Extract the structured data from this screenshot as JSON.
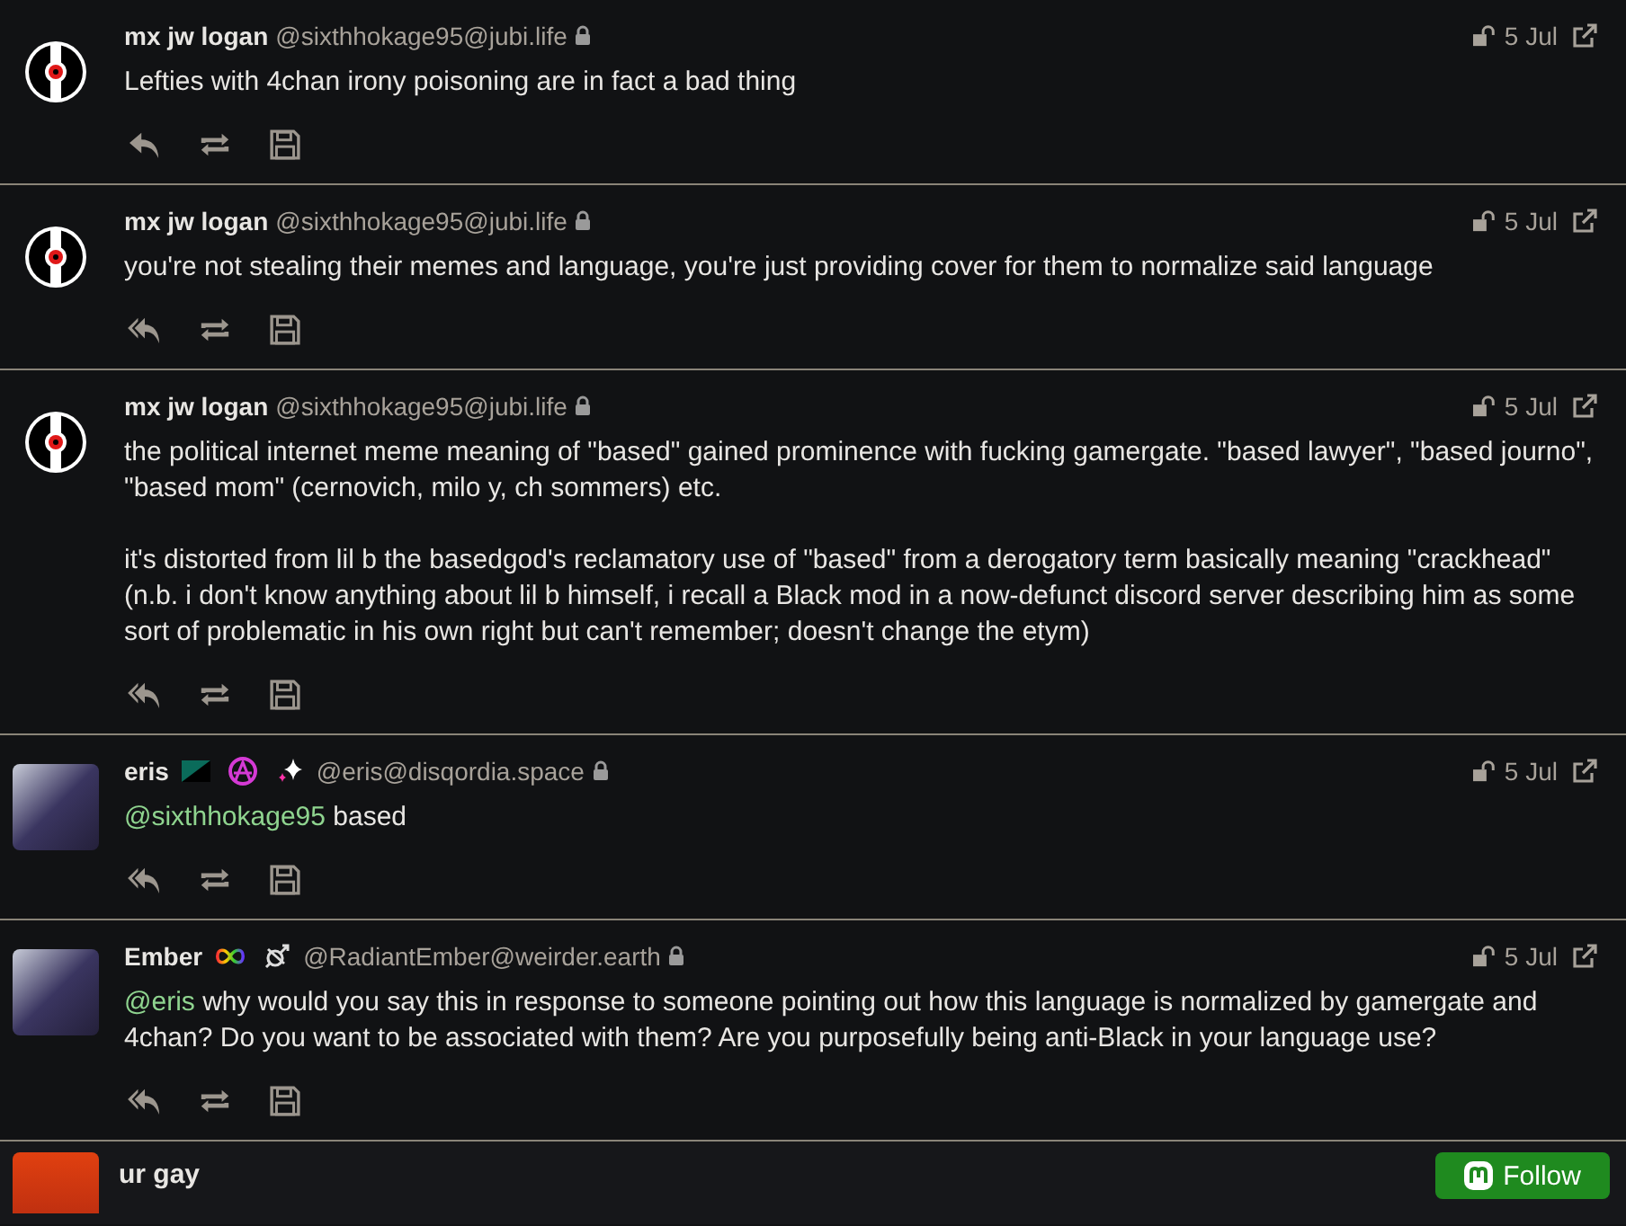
{
  "posts": [
    {
      "name": "mx jw logan",
      "handle": "@sixthhokage95@jubi.life",
      "avatar": {
        "kind": "record"
      },
      "date": "5 Jul",
      "reply": {
        "kind": "single"
      },
      "paragraphs": [
        {
          "text": "Lefties with 4chan irony poisoning are in fact a bad thing"
        }
      ]
    },
    {
      "name": "mx jw logan",
      "handle": "@sixthhokage95@jubi.life",
      "avatar": {
        "kind": "record"
      },
      "date": "5 Jul",
      "reply": {
        "kind": "all"
      },
      "paragraphs": [
        {
          "text": "you're not stealing their memes and language, you're just providing cover for them to normalize said language"
        }
      ]
    },
    {
      "name": "mx jw logan",
      "handle": "@sixthhokage95@jubi.life",
      "avatar": {
        "kind": "record"
      },
      "date": "5 Jul",
      "reply": {
        "kind": "all"
      },
      "paragraphs": [
        {
          "text": "the political internet meme meaning of \"based\" gained prominence with fucking gamergate. \"based lawyer\", \"based journo\", \"based mom\" (cernovich, milo y, ch sommers) etc."
        },
        {
          "text": "it's distorted from lil b the basedgod's reclamatory use of \"based\" from a derogatory term basically meaning \"crackhead\" (n.b. i don't know anything about lil b himself, i recall a Black mod in a now-defunct discord server describing him as some sort of problematic in his own right but can't remember; doesn't change the etym)"
        }
      ]
    },
    {
      "name": "eris",
      "handle": "@eris@disqordia.space",
      "avatar": {
        "kind": "photo"
      },
      "badges": [
        {
          "kind": "flag"
        },
        {
          "kind": "anarchy"
        },
        {
          "kind": "sparkles"
        }
      ],
      "date": "5 Jul",
      "reply": {
        "kind": "all"
      },
      "paragraphs": [
        {
          "mention": "@sixthhokage95",
          "text": "based"
        }
      ]
    },
    {
      "name": "Ember",
      "handle": "@RadiantEmber@weirder.earth",
      "avatar": {
        "kind": "photo"
      },
      "badges": [
        {
          "kind": "infinity"
        },
        {
          "kind": "gender"
        }
      ],
      "date": "5 Jul",
      "reply": {
        "kind": "all"
      },
      "paragraphs": [
        {
          "mention": "@eris",
          "text": "why would you say this in response to someone pointing out how this language is normalized by gamergate and 4chan? Do you want to be associated with them? Are you purposefully being anti-Black in your language use?"
        }
      ]
    }
  ],
  "footer": {
    "text": "ur gay",
    "button": "Follow"
  }
}
